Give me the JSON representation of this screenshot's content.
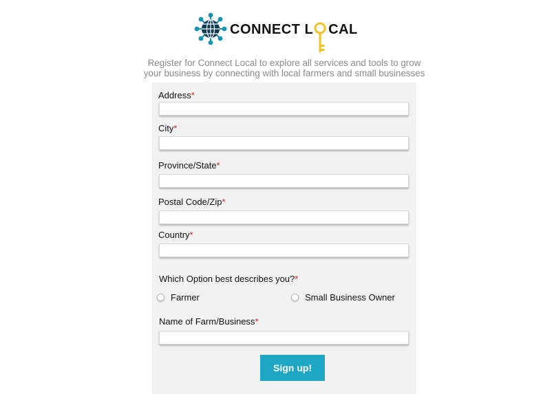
{
  "brand": {
    "name_part1": "CONNECT L",
    "name_part2": "CAL",
    "globe_icon": "globe-network-icon",
    "key_icon": "key-icon",
    "colors": {
      "globe": "#1593b4",
      "key": "#f2c01f",
      "text": "#111111"
    }
  },
  "intro_text": "Register for Connect Local to explore all services and tools to grow your business by connecting with local farmers and small businesses",
  "form": {
    "fields": [
      {
        "label": "Address",
        "value": ""
      },
      {
        "label": "City",
        "value": ""
      },
      {
        "label": "Province/State",
        "value": ""
      },
      {
        "label": "Postal Code/Zip",
        "value": ""
      },
      {
        "label": "Country",
        "value": ""
      }
    ],
    "required_marker": "*",
    "question": "Which Option best describes you?",
    "options": [
      "Farmer",
      "Small Business Owner"
    ],
    "business_field": {
      "label": "Name of Farm/Business",
      "value": ""
    },
    "submit_label": "Sign up!"
  },
  "colors": {
    "panel": "#f2f2f2",
    "button": "#1da7c4",
    "required": "#d32020",
    "intro_text": "#8a8a8a"
  }
}
